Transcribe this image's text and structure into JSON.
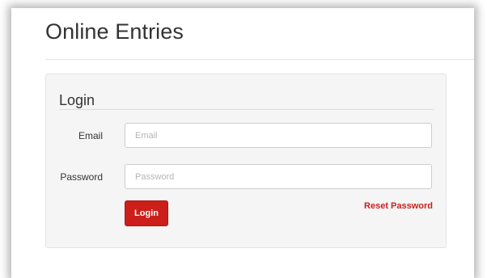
{
  "header": {
    "title": "Online Entries"
  },
  "login_form": {
    "legend": "Login",
    "email": {
      "label": "Email",
      "placeholder": "Email",
      "value": ""
    },
    "password": {
      "label": "Password",
      "placeholder": "Password",
      "value": ""
    },
    "submit_label": "Login",
    "reset_link_label": "Reset Password"
  },
  "colors": {
    "accent": "#cc1f1a",
    "panel_background": "#f5f5f5",
    "text": "#333333"
  }
}
